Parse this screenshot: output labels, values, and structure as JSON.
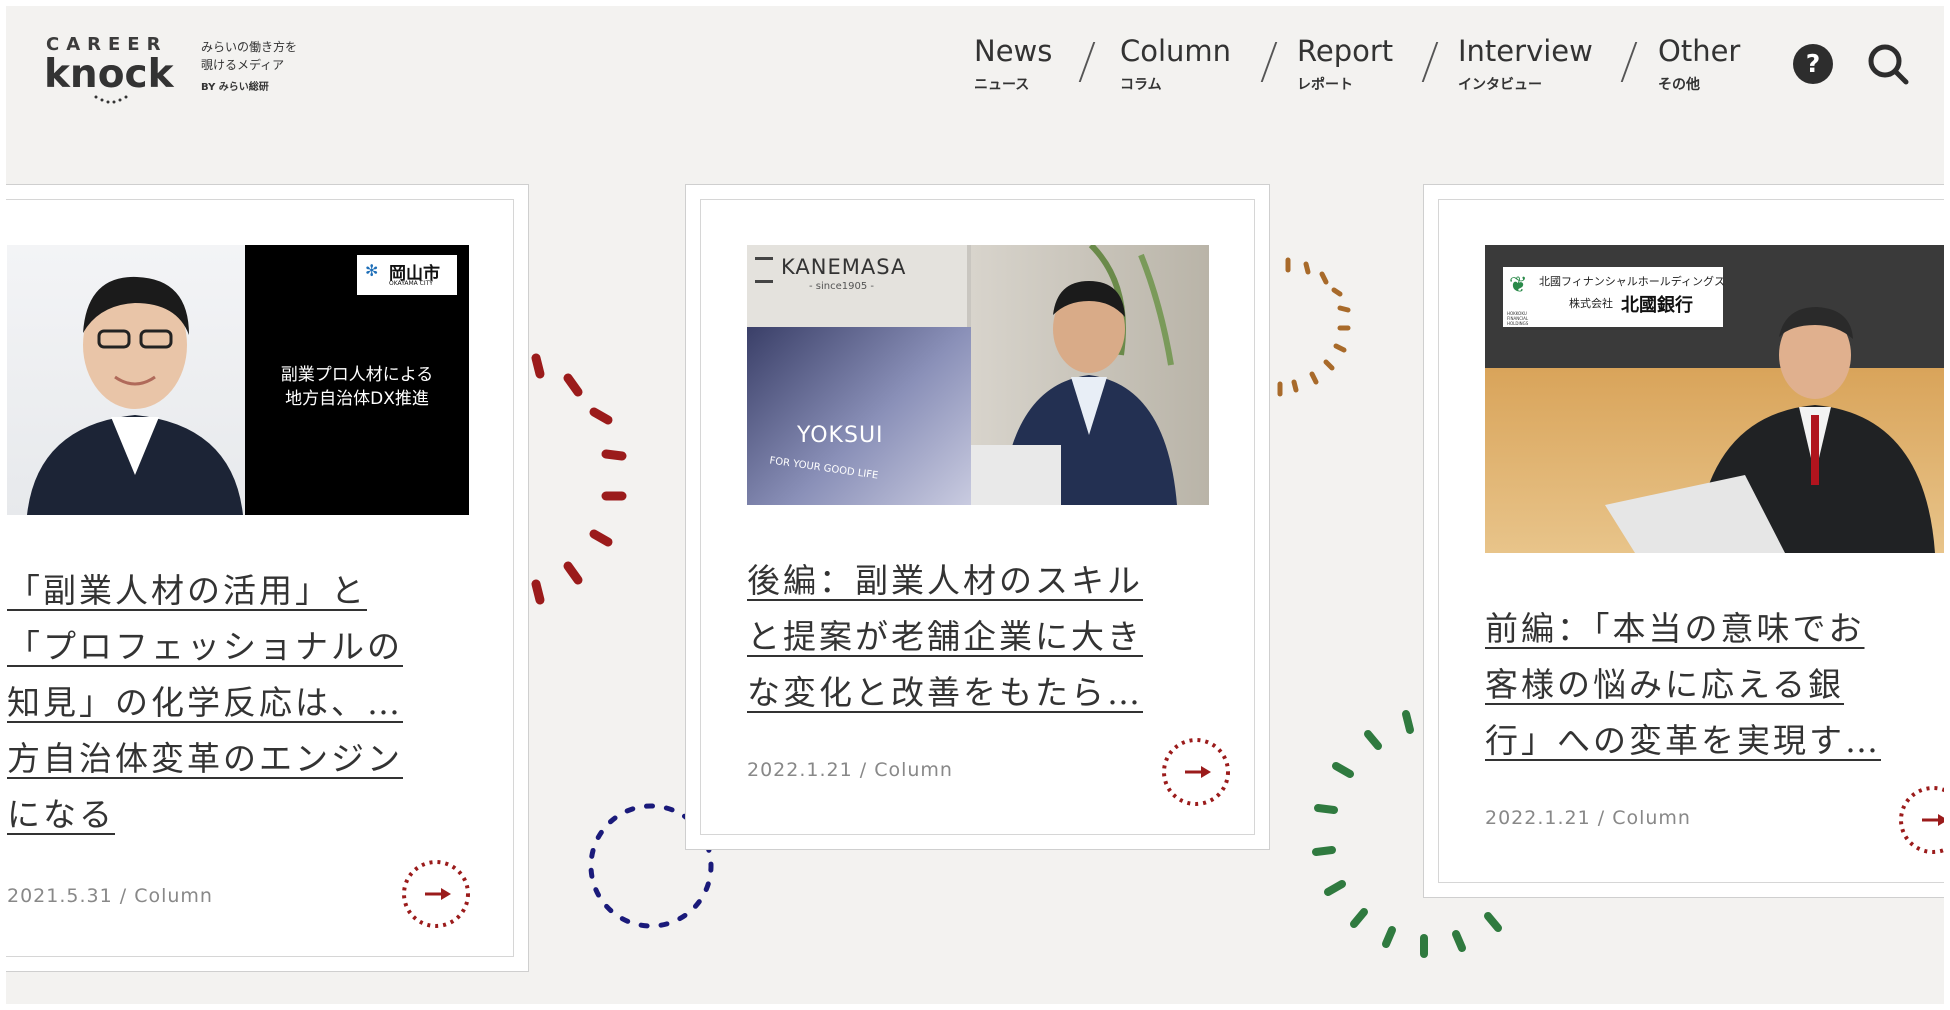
{
  "header": {
    "logo_top": "CAREER",
    "logo_bottom": "knock",
    "tagline_line1": "みらいの働き方を",
    "tagline_line2": "覗けるメディア",
    "byline": "BY みらい総研"
  },
  "nav": [
    {
      "en": "News",
      "ja": "ニュース"
    },
    {
      "en": "Column",
      "ja": "コラム"
    },
    {
      "en": "Report",
      "ja": "レポート"
    },
    {
      "en": "Interview",
      "ja": "インタビュー"
    },
    {
      "en": "Other",
      "ja": "その他"
    }
  ],
  "icons": {
    "help": "?",
    "help_icon_name": "question-circle-icon",
    "search_icon_name": "search-icon"
  },
  "cards": [
    {
      "image_badge": "岡山市",
      "image_badge_sub": "OKAYAMA CITY",
      "image_caption_1": "副業プロ人材による",
      "image_caption_2": "地方自治体DX推進",
      "title_1": "「副業人材の活用」と",
      "title_2": "「プロフェッショナルの",
      "title_3": "知見」の化学反応は、…",
      "title_4": "方自治体変革のエンジン",
      "title_5": "になる",
      "date": "2021.5.31",
      "category": "Column"
    },
    {
      "image_brand": "KANEMASA",
      "image_brand_sub": "- since1905 -",
      "image_screen_text": "YOKSUI",
      "image_screen_sub": "FOR YOUR GOOD LIFE",
      "title_1": "後編：副業人材のスキル",
      "title_2": "と提案が老舗企業に大き",
      "title_3": "な変化と改善をもたら…",
      "date": "2022.1.21",
      "category": "Column"
    },
    {
      "image_badge_1": "北國フィナンシャルホールディングス",
      "image_badge_2": "株式会社",
      "image_badge_3": "北國銀行",
      "image_badge_small": "HOKKOKU FINANCIAL HOLDINGS",
      "title_1": "前編：「本当の意味でお",
      "title_2": "客様の悩みに応える銀",
      "title_3": "行」への変革を実現す…",
      "date": "2022.1.21",
      "category": "Column"
    }
  ],
  "meta_separator": "/",
  "colors": {
    "background": "#f3f2f0",
    "arrow_red": "#9b1b1b",
    "deco_red": "#9b1b1b",
    "deco_orange": "#a86a2a",
    "deco_navy": "#1a1a7a",
    "deco_green": "#2f7a3f"
  }
}
